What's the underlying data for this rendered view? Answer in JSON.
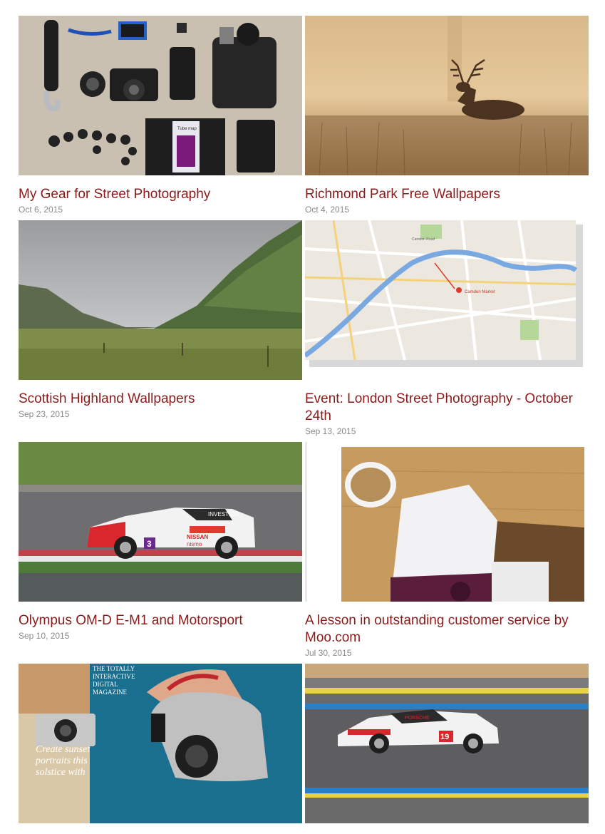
{
  "posts": [
    {
      "title": "My Gear for Street Photography",
      "date": "Oct 6, 2015",
      "image": "camera-gear-flatlay"
    },
    {
      "title": "Richmond Park Free Wallpapers",
      "date": "Oct 4, 2015",
      "image": "deer-in-fog"
    },
    {
      "title": "Scottish Highland Wallpapers",
      "date": "Sep 23, 2015",
      "image": "highland-valley"
    },
    {
      "title": "Event: London Street Photography - October 24th",
      "date": "Sep 13, 2015",
      "image": "london-map"
    },
    {
      "title": "Olympus OM-D E-M1 and Motorsport",
      "date": "Sep 10, 2015",
      "image": "race-car-nissan"
    },
    {
      "title": "A lesson in outstanding customer service by Moo.com",
      "date": "Jul 30, 2015",
      "image": "moo-box-coffee"
    },
    {
      "title": "",
      "date": "",
      "image": "magazine-cover"
    },
    {
      "title": "",
      "date": "",
      "image": "race-car-porsche"
    }
  ],
  "thumbnail_text": {
    "magazine": [
      "THE TOTALLY",
      "INTERACTIVE",
      "DIGITAL",
      "MAGAZINE"
    ],
    "magazine_cover": [
      "Create sunset",
      "portraits this",
      "solstice with"
    ],
    "map_labels": [
      "Camden Market",
      "Camden Road"
    ],
    "car_nissan": [
      "INVESTIGO",
      "NISSAN",
      "nismo",
      "3"
    ],
    "car_porsche": [
      "PORSCHE",
      "19"
    ],
    "gear_book": [
      "Tube map"
    ]
  }
}
